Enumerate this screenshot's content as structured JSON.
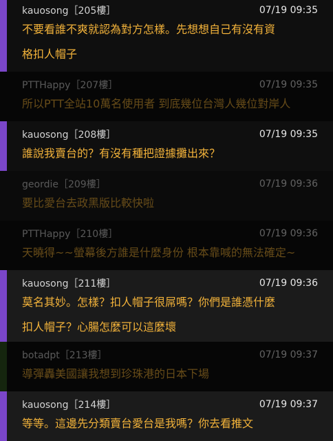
{
  "comments": [
    {
      "user": "kauosong",
      "floor": "［205樓］",
      "time": "07/19 09:35",
      "lines": [
        "不要看誰不爽就認為對方怎樣。先想想自己有沒有資",
        "格扣人帽子"
      ]
    },
    {
      "user": "PTTHappy",
      "floor": "［207樓］",
      "time": "07/19 09:35",
      "lines": [
        "所以PTT全站10萬名使用者 到底幾位台灣人幾位對岸人"
      ]
    },
    {
      "user": "kauosong",
      "floor": "［208樓］",
      "time": "07/19 09:35",
      "lines": [
        "誰說我賣台的？有沒有種把證據攤出來？"
      ]
    },
    {
      "user": "geordie",
      "floor": "［209樓］",
      "time": "07/19 09:36",
      "lines": [
        "要比愛台去政黑版比較快啦"
      ]
    },
    {
      "user": "PTTHappy",
      "floor": "［210樓］",
      "time": "07/19 09:36",
      "lines": [
        "天曉得~~螢幕後方誰是什麼身份 根本靠喊的無法確定~"
      ]
    },
    {
      "user": "kauosong",
      "floor": "［211樓］",
      "time": "07/19 09:36",
      "lines": [
        "莫名其妙。怎樣？扣人帽子很屌嗎？你們是誰憑什麼",
        "扣人帽子？心腸怎麼可以這麼壞"
      ]
    },
    {
      "user": "botadpt",
      "floor": "［213樓］",
      "time": "07/19 09:37",
      "lines": [
        "導彈轟美國讓我想到珍珠港的日本下場"
      ]
    },
    {
      "user": "kauosong",
      "floor": "［214樓］",
      "time": "07/19 09:37",
      "lines": [
        "等等。這邊先分類賣台愛台是我嗎？你去看推文"
      ]
    }
  ],
  "colors": {
    "accent_purple": "#7b46c9",
    "accent_green": "#335a22",
    "content_text": "#f2b23a"
  }
}
